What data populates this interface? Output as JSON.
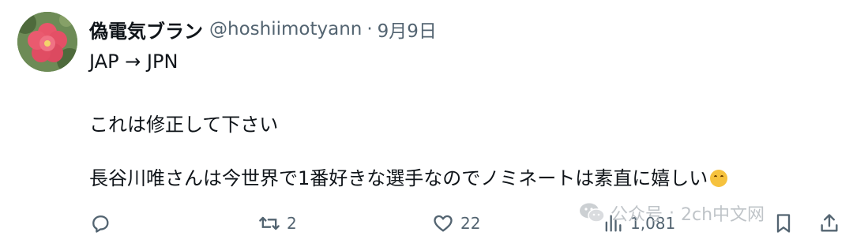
{
  "tweet": {
    "author_name": "偽電気ブラン",
    "handle": "@hoshiimotyann",
    "separator": "·",
    "date": "9月9日",
    "lines": [
      "JAP  → JPN",
      "これは修正して下さい",
      "長谷川唯さんは今世界で1番好きな選手なのでノミネートは素直に嬉しい"
    ],
    "emoji": "smiling-face-emoji"
  },
  "actions": {
    "reply_icon": "reply-icon",
    "retweet_icon": "retweet-icon",
    "retweet_count": "2",
    "like_icon": "heart-icon",
    "like_count": "22",
    "views_icon": "views-icon",
    "views_count": "1,081",
    "bookmark_icon": "bookmark-icon",
    "share_icon": "share-icon"
  },
  "watermark": {
    "icon": "wechat-icon",
    "text_left": "公众号",
    "separator": "·",
    "text_right": "2ch中文网"
  },
  "colors": {
    "text": "#0f1419",
    "muted": "#536471",
    "watermark": "#b9bec3"
  }
}
